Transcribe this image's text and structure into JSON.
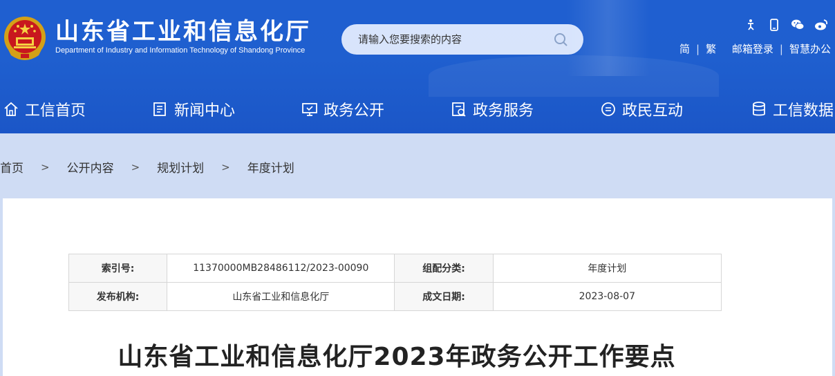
{
  "header": {
    "title": "山东省工业和信息化厅",
    "subtitle": "Department of Industry and Information Technology of Shandong Province",
    "search_placeholder": "请输入您要搜索的内容",
    "top_icons": [
      "accessibility-icon",
      "mobile-icon",
      "wechat-icon",
      "weibo-icon"
    ],
    "links": {
      "simplified": "简",
      "traditional": "繁",
      "mail_login": "邮箱登录",
      "smart_office": "智慧办公"
    }
  },
  "nav": {
    "items": [
      {
        "label": "工信首页",
        "icon": "home-icon"
      },
      {
        "label": "新闻中心",
        "icon": "news-icon"
      },
      {
        "label": "政务公开",
        "icon": "monitor-icon"
      },
      {
        "label": "政务服务",
        "icon": "service-icon"
      },
      {
        "label": "政民互动",
        "icon": "chat-icon"
      },
      {
        "label": "工信数据",
        "icon": "database-icon"
      }
    ]
  },
  "breadcrumb": {
    "items": [
      "首页",
      "公开内容",
      "规划计划",
      "年度计划"
    ],
    "separator": ">"
  },
  "meta": {
    "index_label": "索引号:",
    "index_value": "11370000MB28486112/2023-00090",
    "category_label": "组配分类:",
    "category_value": "年度计划",
    "publisher_label": "发布机构:",
    "publisher_value": "山东省工业和信息化厅",
    "date_label": "成文日期:",
    "date_value": "2023-08-07"
  },
  "document": {
    "title": "山东省工业和信息化厅2023年政务公开工作要点"
  },
  "colors": {
    "header_blue": "#1f5fd0",
    "breadcrumb_bg": "#cfdcf4"
  }
}
